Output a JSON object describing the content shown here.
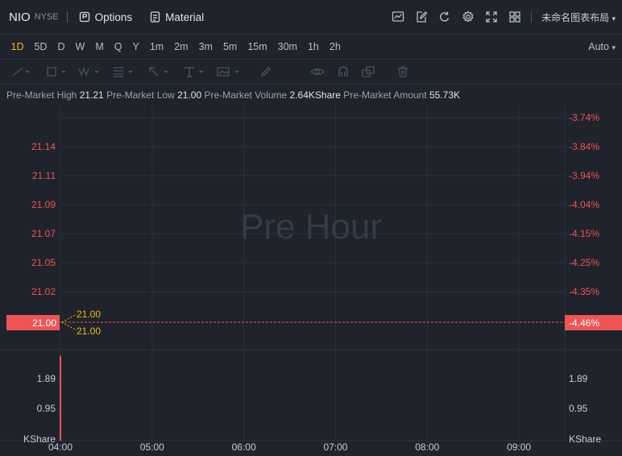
{
  "header": {
    "symbol": "NIO",
    "exchange": "NYSE",
    "options_label": "Options",
    "material_label": "Material",
    "layout_name": "未命名图表布局"
  },
  "toolbar_icons": [
    "line-chart-icon",
    "edit-icon",
    "reset-icon",
    "settings-icon",
    "fullscreen-icon",
    "grid-layout-icon"
  ],
  "timeframes": [
    "1D",
    "5D",
    "D",
    "W",
    "M",
    "Q",
    "Y",
    "1m",
    "2m",
    "3m",
    "5m",
    "15m",
    "30m",
    "1h",
    "2h"
  ],
  "active_timeframe": "1D",
  "scale_mode": "Auto",
  "drawing_tools": [
    "trend-line-icon",
    "rectangle-icon",
    "pattern-icon",
    "fibonacci-icon",
    "arrow-icon",
    "text-tool-icon",
    "image-icon",
    "pencil-icon",
    "visibility-icon",
    "magnet-icon",
    "lock-icon",
    "trash-icon"
  ],
  "stats": [
    {
      "label": "Pre-Market High",
      "value": "21.21"
    },
    {
      "label": "Pre-Market Low",
      "value": "21.00"
    },
    {
      "label": "Pre-Market Volume",
      "value": "2.64KShare"
    },
    {
      "label": "Pre-Market Amount",
      "value": "55.73K"
    }
  ],
  "watermark": "Pre Hour",
  "colors": {
    "background": "#1e232c",
    "grid": "#2c323c",
    "accent": "#f0b90b",
    "down": "#f05454"
  },
  "chart_data": {
    "type": "line",
    "price_ticks": [
      "21.14",
      "21.11",
      "21.09",
      "21.07",
      "21.05",
      "21.02"
    ],
    "pct_ticks": [
      "-3.74%",
      "-3.84%",
      "-3.94%",
      "-4.04%",
      "-4.15%",
      "-4.25%",
      "-4.35%"
    ],
    "current_price": "21.00",
    "current_pct": "-4.46%",
    "price_range": [
      20.99,
      21.16
    ],
    "callouts": [
      {
        "label": "21.00"
      },
      {
        "label": "21.00"
      }
    ],
    "volume_ticks": [
      "1.89",
      "0.95"
    ],
    "volume_unit": "KShare",
    "time_ticks": [
      "04:00",
      "05:00",
      "06:00",
      "07:00",
      "08:00",
      "09:00"
    ],
    "volume_bars": [
      {
        "time": "04:00",
        "value": 2.64
      }
    ],
    "volume_range": [
      0,
      2.83
    ]
  }
}
